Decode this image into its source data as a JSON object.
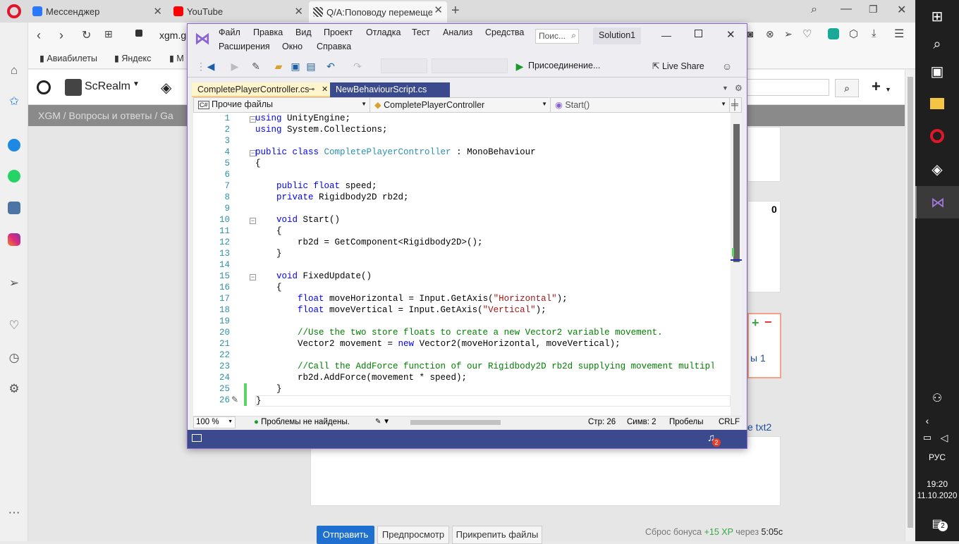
{
  "opera": {
    "tabs": [
      {
        "title": "Мессенджер",
        "color": "#2979ff"
      },
      {
        "title": "YouTube",
        "color": "#ff0000"
      },
      {
        "title": "Q/A:Поповоду перемеще",
        "color": "#444444"
      }
    ],
    "address": "xgm.g",
    "bookmarks": [
      "Авиабилеты",
      "Яндекс",
      "М"
    ]
  },
  "site": {
    "logo": "ScRealm",
    "crumbs": "XGM  /  Вопросы и ответы  /  Ga",
    "score": "0",
    "points_label": "ы 1",
    "txt2_link": "е txt2",
    "buttons": {
      "send": "Отправить",
      "preview": "Предпросмотр",
      "attach": "Прикрепить файлы"
    },
    "bonus": {
      "prefix": "Сброс бонуса ",
      "xp": "+15 XP",
      "middle": " через ",
      "time": "5:05с"
    }
  },
  "vs": {
    "menu_row1": [
      "Файл",
      "Правка",
      "Вид",
      "Проект",
      "Отладка",
      "Тест",
      "Анализ",
      "Средства"
    ],
    "menu_row2": [
      "Расширения",
      "Окно",
      "Справка"
    ],
    "search_placeholder": "Поис...",
    "solution": "Solution1",
    "attach_label": "Присоединение...",
    "live_share": "Live Share",
    "tabs": [
      {
        "label": "CompletePlayerController.cs",
        "pin": "⊸",
        "close": "✕"
      },
      {
        "label": "NewBehaviourScript.cs"
      }
    ],
    "nav": {
      "project": "Прочие файлы",
      "class": "CompletePlayerController",
      "member": "Start()"
    },
    "line_numbers": [
      "1",
      "2",
      "3",
      "4",
      "5",
      "6",
      "7",
      "8",
      "9",
      "10",
      "11",
      "12",
      "13",
      "14",
      "15",
      "16",
      "17",
      "18",
      "19",
      "20",
      "21",
      "22",
      "23",
      "24",
      "25",
      "26"
    ],
    "status": {
      "zoom": "100 %",
      "problems": "Проблемы не найдены.",
      "line": "Стр: 26",
      "col": "Симв: 2",
      "ws": "Пробелы",
      "eol": "CRLF"
    },
    "notifications": "2"
  },
  "taskbar": {
    "lang": "РУС",
    "time": "19:20",
    "date": "11.10.2020",
    "notif_count": "2"
  }
}
